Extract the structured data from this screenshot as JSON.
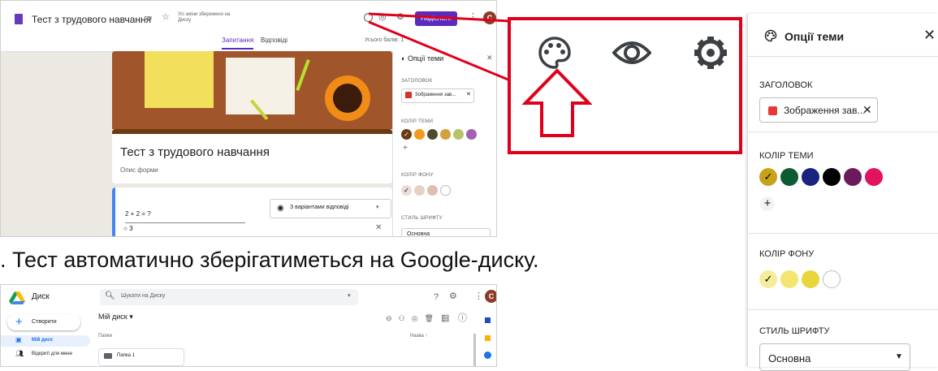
{
  "forms": {
    "title": "Тест з трудового навчання",
    "saved_status": "Усі зміни збережено на Диску",
    "send_label": "Надіслати",
    "avatar_letter": "C",
    "tabs": [
      "Запитання",
      "Відповіді"
    ],
    "total_points": "Усього балів: 1",
    "form_title": "Тест з трудового навчання",
    "form_description": "Опис форми",
    "question_text": "2 + 2 = ?",
    "question_type": "З варіантами відповіді",
    "option_1": "3",
    "theme_panel": {
      "title": "Опції теми",
      "header_label": "ЗАГОЛОВОК",
      "header_chip": "Зображення зав...",
      "theme_color_label": "КОЛІР ТЕМИ",
      "bg_color_label": "КОЛІР ФОНУ",
      "font_style_label": "СТИЛЬ ШРИФТУ",
      "font_style_value": "Основна",
      "theme_colors": [
        "#6b3a12",
        "#f29a1d",
        "#4e4b2c",
        "#d4a03a",
        "#b5c36a",
        "#a35fb3"
      ],
      "bg_colors": [
        "#e9ddd6",
        "#e8d0c2",
        "#dcc0b0",
        "#ffffff"
      ]
    }
  },
  "zoom": {
    "icons": [
      "palette-icon",
      "eye-icon",
      "gear-icon"
    ]
  },
  "caption": "Тест автоматично зберігатиметься на Google-диску.",
  "caption_prefix": ".",
  "drive": {
    "app_name": "Диск",
    "search_placeholder": "Шукати на Диску",
    "create_label": "Створити",
    "my_drive_label": "Мій диск",
    "my_drive_menu": "Мій диск",
    "shared_label": "Відкриті для мене",
    "folders_label": "Папки",
    "sort_label": "Назва",
    "folder_1": "Папка 1",
    "avatar_letter": "C"
  },
  "theme": {
    "title": "Опції теми",
    "header_label": "ЗАГОЛОВОК",
    "header_chip": "Зображення зав...",
    "theme_color_label": "КОЛІР ТЕМИ",
    "bg_color_label": "КОЛІР ФОНУ",
    "font_style_label": "СТИЛЬ ШРИФТУ",
    "font_style_value": "Основна",
    "theme_colors": [
      "#c8a21a",
      "#0d5b35",
      "#1a237e",
      "#000000",
      "#6b1b5c",
      "#e2125e"
    ],
    "bg_colors": [
      "#f6ec9a",
      "#f2e66e",
      "#e9d63c",
      "#ffffff"
    ],
    "accent": "#e0001a"
  }
}
